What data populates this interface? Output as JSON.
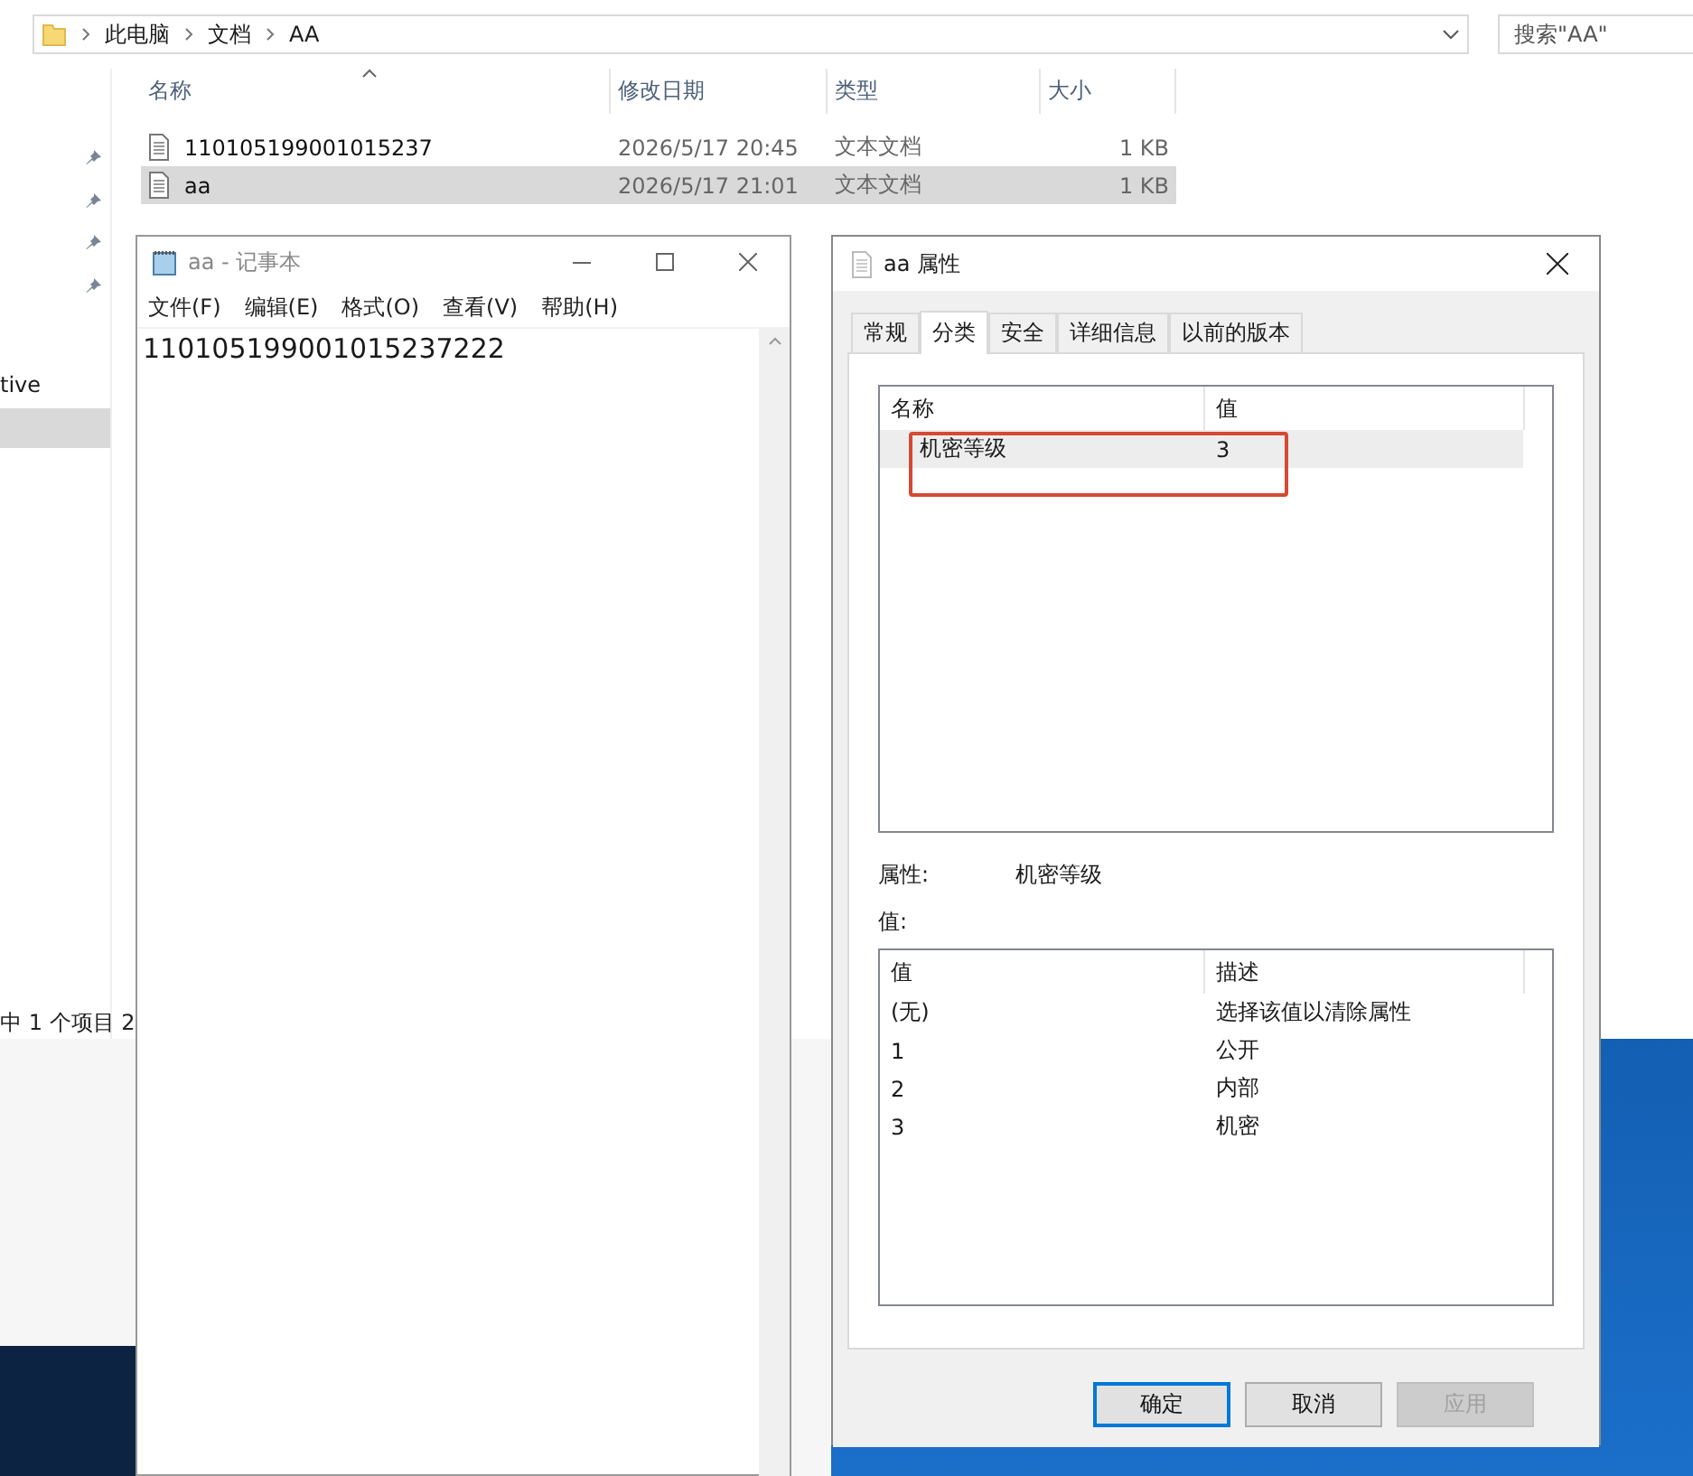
{
  "explorer": {
    "breadcrumb": [
      "此电脑",
      "文档",
      "AA"
    ],
    "search": {
      "placeholder": "搜索\"AA\""
    },
    "columns": [
      "名称",
      "修改日期",
      "类型",
      "大小"
    ],
    "files": [
      {
        "name": "110105199001015237",
        "modified": "2026/5/17 20:45",
        "type": "文本文档",
        "size": "1 KB",
        "selected": false
      },
      {
        "name": "aa",
        "modified": "2026/5/17 21:01",
        "type": "文本文档",
        "size": "1 KB",
        "selected": true
      }
    ],
    "nav_fragment": "tive",
    "status_text": "中 1 个项目  2"
  },
  "notepad": {
    "title": "aa - 记事本",
    "menu": [
      "文件(F)",
      "编辑(E)",
      "格式(O)",
      "查看(V)",
      "帮助(H)"
    ],
    "content": "110105199001015237222"
  },
  "properties": {
    "title": "aa 属性",
    "tabs": [
      {
        "label": "常规",
        "selected": false
      },
      {
        "label": "分类",
        "selected": true
      },
      {
        "label": "安全",
        "selected": false
      },
      {
        "label": "详细信息",
        "selected": false
      },
      {
        "label": "以前的版本",
        "selected": false
      }
    ],
    "property_columns": [
      "名称",
      "值"
    ],
    "property_rows": [
      {
        "name": "机密等级",
        "value": "3",
        "selected": true,
        "annotated": true
      }
    ],
    "property_label": "属性:",
    "property_value": "机密等级",
    "value_label": "值:",
    "value_columns": [
      "值",
      "描述"
    ],
    "value_rows": [
      {
        "value": "(无)",
        "description": "选择该值以清除属性"
      },
      {
        "value": "1",
        "description": "公开"
      },
      {
        "value": "2",
        "description": "内部"
      },
      {
        "value": "3",
        "description": "机密"
      }
    ],
    "buttons": [
      {
        "label": "确定",
        "kind": "default",
        "disabled": false
      },
      {
        "label": "取消",
        "kind": "normal",
        "disabled": false
      },
      {
        "label": "应用",
        "kind": "normal",
        "disabled": true
      }
    ]
  }
}
